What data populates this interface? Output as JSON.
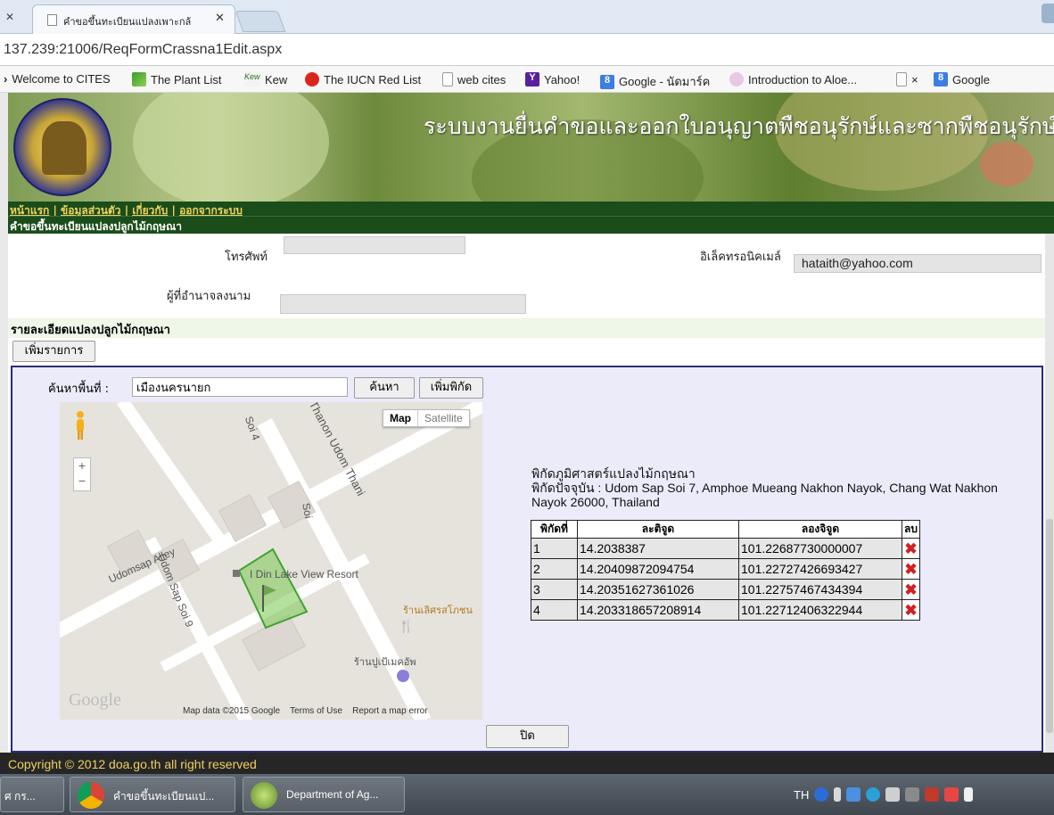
{
  "browser": {
    "tab_title": "คำขอขึ้นทะเบียนแปลงเพาะกล้",
    "url": "137.239:21006/ReqFormCrassna1Edit.aspx",
    "bookmarks": [
      "Welcome to CITES",
      "The Plant List",
      "Kew",
      "The IUCN Red List",
      "web cites",
      "Yahoo!",
      "Google - นัดมาร์ค",
      "Introduction to Aloe...",
      "×",
      "Google"
    ]
  },
  "header": {
    "title": "ระบบงานยื่นคำขอและออกใบอนุญาตพืชอนุรักษ์และซากพืชอนุรักษ์",
    "nav": [
      "หน้าแรก",
      "ข้อมูลส่วนตัว",
      "เกี่ยวกับ",
      "ออกจากระบบ"
    ],
    "nav_sep": " | ",
    "page_title": "คำขอขึ้นทะเบียนแปลงปลูกไม้กฤษณา"
  },
  "form": {
    "phone_label": "โทรศัพท์",
    "phone_value": "",
    "email_label": "อิเล็คทรอนิคเมล์",
    "email_value": "hataith@yahoo.com",
    "authorized_label": "ผู้ที่อำนาจลงนาม",
    "authorized_value": "",
    "section_title": "รายละเอียดแปลงปลูกไม้กฤษณา",
    "add_button": "เพิ่มรายการ"
  },
  "panel": {
    "search_label": "ค้นหาพื้นที่ :",
    "search_value": "เมืองนครนายก",
    "search_button": "ค้นหา",
    "add_coord_button": "เพิ่มพิกัด",
    "close_button": "ปิด",
    "coord_title": "พิกัดภูมิศาสตร์แปลงไม้กฤษณา",
    "current_coord": "พิกัดปัจจุบัน : Udom Sap Soi 7, Amphoe Mueang Nakhon Nayok, Chang Wat Nakhon Nayok 26000, Thailand",
    "table_headers": [
      "พิกัดที่",
      "ละติจูด",
      "ลองจิจูด",
      "ลบ"
    ],
    "rows": [
      {
        "no": "1",
        "lat": "14.2038387",
        "lng": "101.22687730000007"
      },
      {
        "no": "2",
        "lat": "14.20409872094754",
        "lng": "101.22727426693427"
      },
      {
        "no": "3",
        "lat": "14.20351627361026",
        "lng": "101.22757467434394"
      },
      {
        "no": "4",
        "lat": "14.203318657208914",
        "lng": "101.22712406322944"
      }
    ]
  },
  "map": {
    "type_map": "Map",
    "type_satellite": "Satellite",
    "labels": [
      "Soi 4",
      "Thanon Udom Thani",
      "Udomsap Alley",
      "Udom Sap Soi 9",
      "Soi",
      "I Din Lake View Resort",
      "ร้านเลิศรสโภชน",
      "ร้านปูเป้เมคอัพ"
    ],
    "logo": "Google",
    "footer": [
      "Map data ©2015 Google",
      "Terms of Use",
      "Report a map error"
    ]
  },
  "footer": {
    "copyright": "Copyright © 2012 doa.go.th all right reserved"
  },
  "taskbar": {
    "items": [
      "ศ กร...",
      "คำขอขึ้นทะเบียนแป...",
      "Department of Ag..."
    ],
    "lang": "TH"
  }
}
